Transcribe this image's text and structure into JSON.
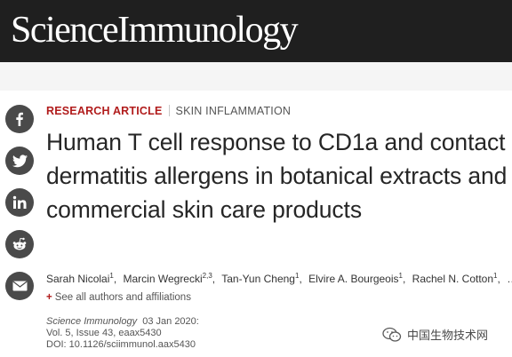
{
  "masthead": {
    "brand": "ScienceImmunology"
  },
  "share": [
    {
      "icon": "facebook-icon"
    },
    {
      "icon": "twitter-icon"
    },
    {
      "icon": "linkedin-icon"
    },
    {
      "icon": "reddit-icon"
    },
    {
      "icon": "email-icon"
    }
  ],
  "article": {
    "type": "RESEARCH ARTICLE",
    "subject": "SKIN INFLAMMATION",
    "title": "Human T cell response to CD1a and contact dermatitis allergens in botanical extracts and commercial skin care products",
    "authors": [
      {
        "name": "Sarah Nicolai",
        "aff": "1"
      },
      {
        "name": "Marcin Wegrecki",
        "aff": "2,3"
      },
      {
        "name": "Tan-Yun Cheng",
        "aff": "1"
      },
      {
        "name": "Elvire A. Bourgeois",
        "aff": "1"
      },
      {
        "name": "Rachel N. Cotton",
        "aff": "1"
      }
    ],
    "authors_more": "…",
    "see_all": "See all authors and affiliations",
    "see_all_plus": "+",
    "citation": {
      "journal": "Science Immunology",
      "date": "03 Jan 2020:",
      "volume_line": "Vol. 5, Issue 43, eaax5430",
      "doi_line": "DOI: 10.1126/sciimmunol.aax5430"
    }
  },
  "watermark": {
    "text": "中国生物技术网"
  }
}
